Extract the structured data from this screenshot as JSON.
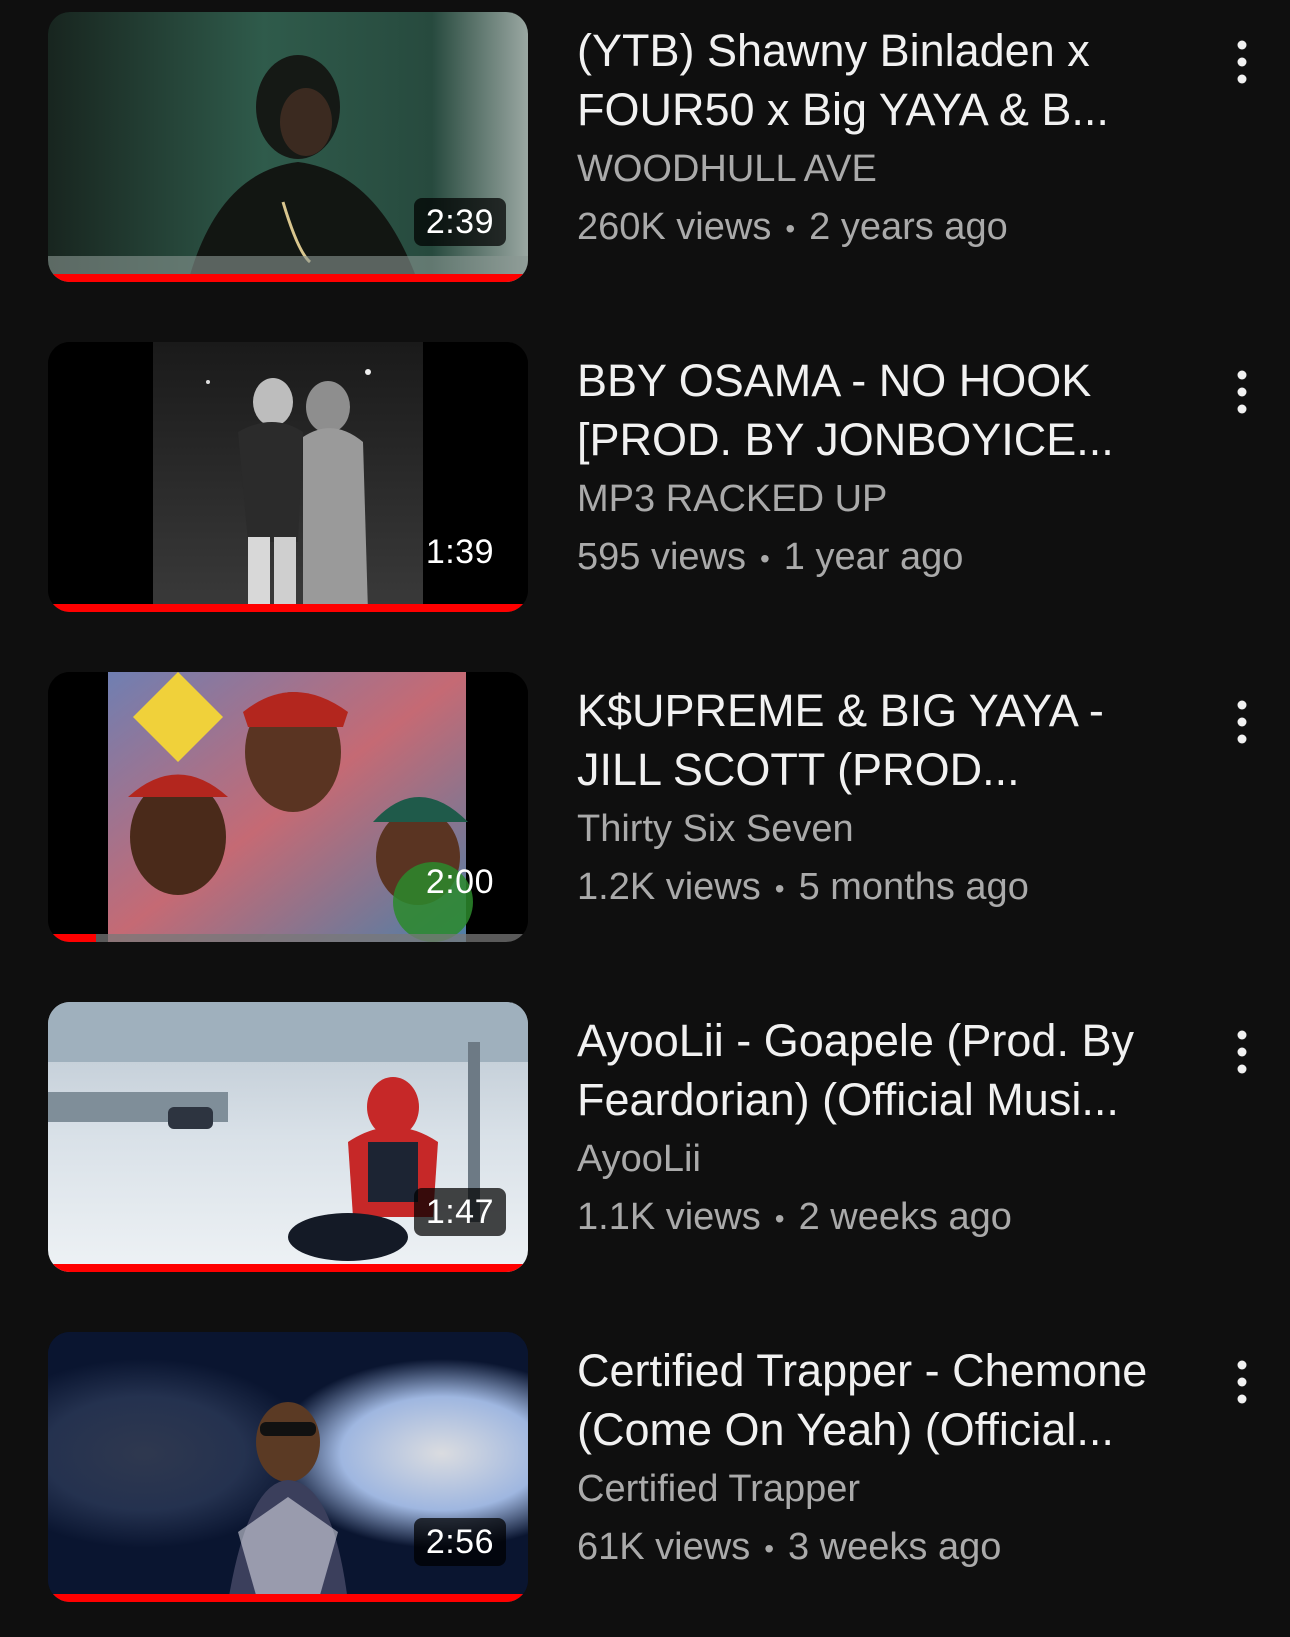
{
  "videos": [
    {
      "title": "(YTB) Shawny Binladen x\nFOUR50 x Big YAYA & B...",
      "channel": "WOODHULL AVE",
      "views": "260K views",
      "age": "2 years ago",
      "duration": "2:39",
      "watch_progress": 1.0,
      "menu_icon": "more-vert-icon"
    },
    {
      "title": "BBY OSAMA - NO HOOK\n[PROD. BY JONBOYICE...",
      "channel": "MP3 RACKED UP",
      "views": "595 views",
      "age": "1 year ago",
      "duration": "1:39",
      "watch_progress": 1.0,
      "menu_icon": "more-vert-icon"
    },
    {
      "title": "K$UPREME & BIG YAYA -\nJILL SCOTT (PROD...",
      "channel": "Thirty Six Seven",
      "views": "1.2K views",
      "age": "5 months ago",
      "duration": "2:00",
      "watch_progress": 0.1,
      "menu_icon": "more-vert-icon"
    },
    {
      "title": "AyooLii - Goapele (Prod. By\nFeardorian) (Official Musi...",
      "channel": "AyooLii",
      "views": "1.1K views",
      "age": "2 weeks ago",
      "duration": "1:47",
      "watch_progress": 1.0,
      "menu_icon": "more-vert-icon"
    },
    {
      "title": "Certified Trapper - Chemone\n(Come On Yeah) (Official...",
      "channel": "Certified Trapper",
      "views": "61K views",
      "age": "3 weeks ago",
      "duration": "2:56",
      "watch_progress": 1.0,
      "menu_icon": "more-vert-icon"
    }
  ],
  "colors": {
    "background": "#0f0f0f",
    "text_primary": "#f1f1f1",
    "text_secondary": "#aaaaaa",
    "progress": "#ff0000"
  }
}
